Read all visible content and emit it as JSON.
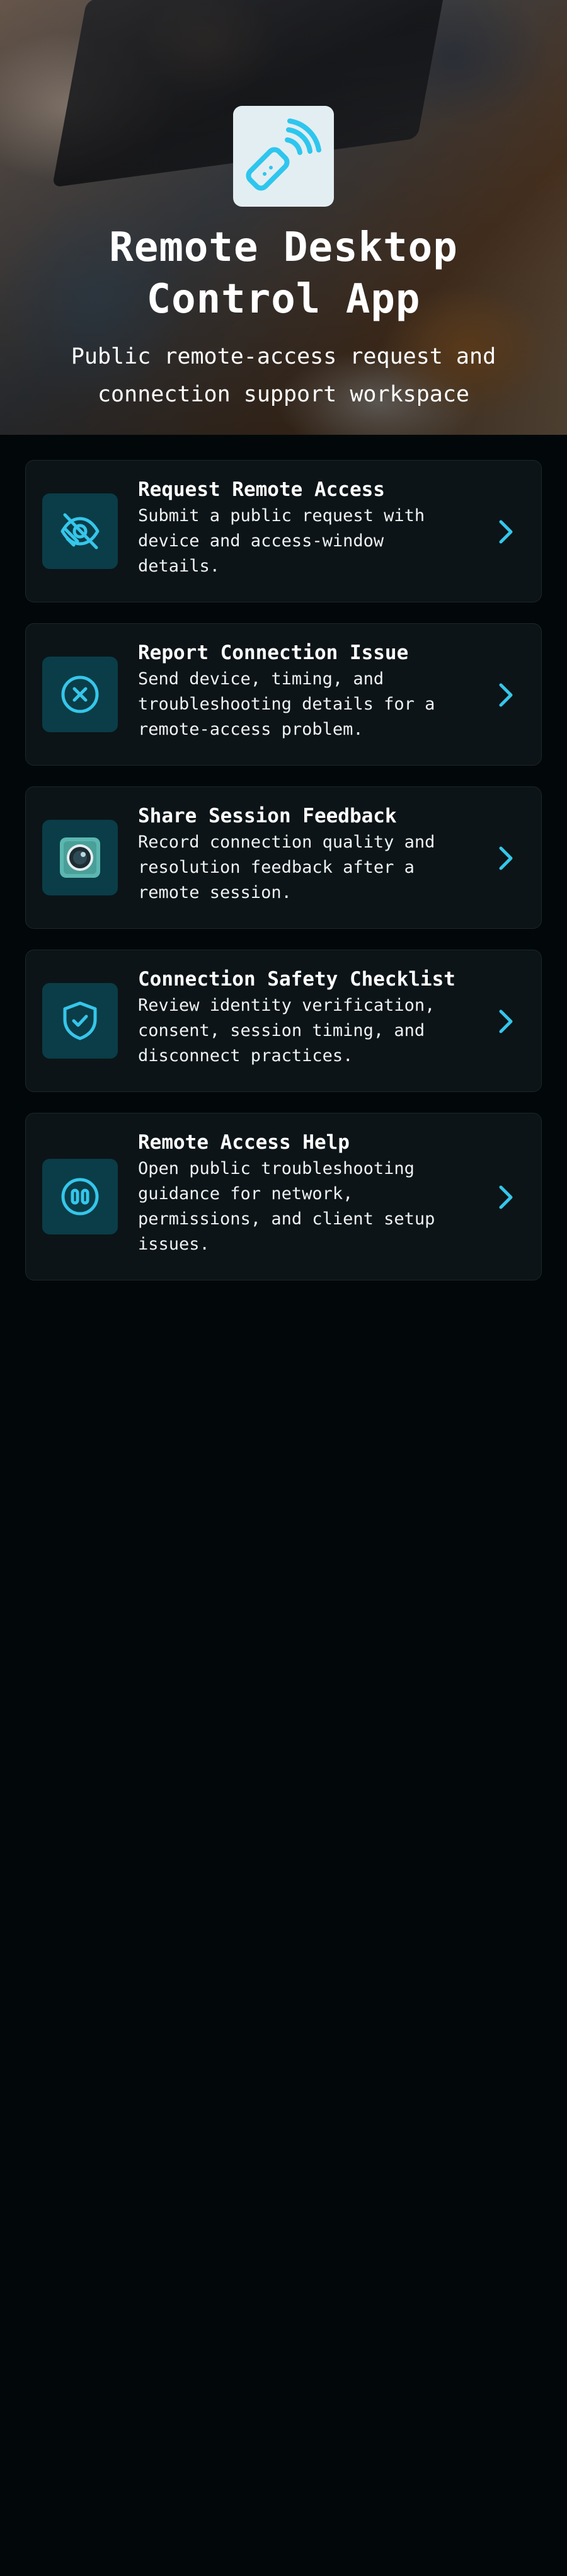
{
  "hero": {
    "title": "Remote Desktop Control App",
    "subtitle": "Public remote-access request and connection support workspace",
    "icon": "remote-signal-icon"
  },
  "cards": [
    {
      "title": "Request Remote Access",
      "description": "Submit a public request with device and access-window details.",
      "icon": "eye-off-icon"
    },
    {
      "title": "Report Connection Issue",
      "description": "Send device, timing, and troubleshooting details for a remote-access problem.",
      "icon": "close-circle-icon"
    },
    {
      "title": "Share Session Feedback",
      "description": "Record connection quality and resolution feedback after a remote session.",
      "icon": "camera-lens-icon"
    },
    {
      "title": "Connection Safety Checklist",
      "description": "Review identity verification, consent, session timing, and disconnect practices.",
      "icon": "shield-check-icon"
    },
    {
      "title": "Remote Access Help",
      "description": "Open public troubleshooting guidance for network, permissions, and client setup issues.",
      "icon": "pause-circle-icon"
    }
  ],
  "colors": {
    "background": "#02080a",
    "card": "#0c1417",
    "icon_tile": "#0a3d48",
    "accent": "#38c8ea"
  }
}
